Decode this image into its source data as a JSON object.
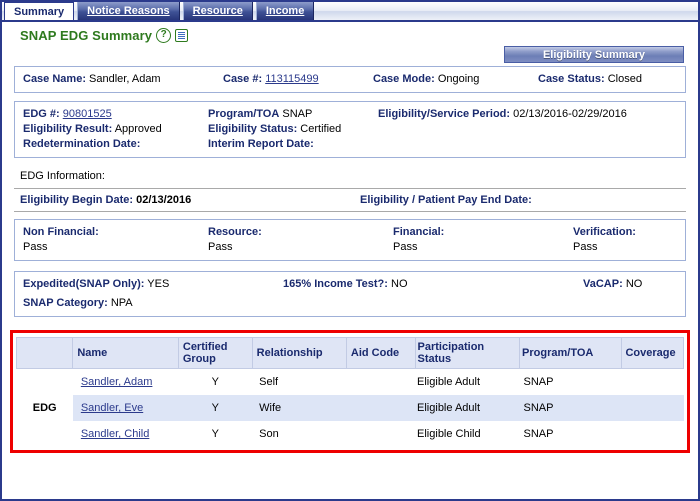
{
  "tabs": [
    {
      "label": "Summary",
      "active": true
    },
    {
      "label": "Notice Reasons",
      "active": false
    },
    {
      "label": "Resource",
      "active": false
    },
    {
      "label": "Income",
      "active": false
    }
  ],
  "page": {
    "title": "SNAP EDG Summary",
    "help_icon": "?",
    "doc_icon": "document-icon"
  },
  "buttons": {
    "eligibility_summary": "Eligibility Summary"
  },
  "case_bar": {
    "case_name_label": "Case Name:",
    "case_name_value": "Sandler, Adam",
    "case_number_label": "Case #:",
    "case_number_value": "113115499",
    "case_mode_label": "Case Mode:",
    "case_mode_value": "Ongoing",
    "case_status_label": "Case Status:",
    "case_status_value": "Closed"
  },
  "edg_panel": {
    "edg_num_label": "EDG #:",
    "edg_num_value": "90801525",
    "program_toa_label": "Program/TOA",
    "program_toa_value": "SNAP",
    "elig_service_period_label": "Eligibility/Service Period:",
    "elig_service_period_value": "02/13/2016-02/29/2016",
    "elig_result_label": "Eligibility Result:",
    "elig_result_value": "Approved",
    "elig_status_label": "Eligibility Status:",
    "elig_status_value": "Certified",
    "redetermination_label": "Redetermination Date:",
    "redetermination_value": "",
    "interim_report_label": "Interim Report Date:",
    "interim_report_value": ""
  },
  "edg_information": {
    "heading": "EDG Information:",
    "begin_date_label": "Eligibility Begin Date:",
    "begin_date_value": "02/13/2016",
    "end_date_label": "Eligibility / Patient Pay End Date:",
    "end_date_value": ""
  },
  "status_panel": {
    "non_financial_label": "Non Financial:",
    "non_financial_value": "Pass",
    "resource_label": "Resource:",
    "resource_value": "Pass",
    "financial_label": "Financial:",
    "financial_value": "Pass",
    "verification_label": "Verification:",
    "verification_value": "Pass"
  },
  "snap_panel": {
    "expedited_label": "Expedited(SNAP Only):",
    "expedited_value": "YES",
    "income_test_label": "165% Income Test?:",
    "income_test_value": "NO",
    "vacap_label": "VaCAP:",
    "vacap_value": "NO",
    "snap_category_label": "SNAP Category:",
    "snap_category_value": "NPA"
  },
  "member_table": {
    "group_label": "EDG",
    "columns": [
      "",
      "Name",
      "Certified Group",
      "Relationship",
      "Aid Code",
      "Participation Status",
      "Program/TOA",
      "Coverage"
    ],
    "rows": [
      {
        "name": "Sandler, Adam",
        "certified_group": "Y",
        "relationship": "Self",
        "aid_code": "",
        "participation_status": "Eligible Adult",
        "program_toa": "SNAP",
        "coverage": ""
      },
      {
        "name": "Sandler, Eve",
        "certified_group": "Y",
        "relationship": "Wife",
        "aid_code": "",
        "participation_status": "Eligible Adult",
        "program_toa": "SNAP",
        "coverage": ""
      },
      {
        "name": "Sandler, Child",
        "certified_group": "Y",
        "relationship": "Son",
        "aid_code": "",
        "participation_status": "Eligible Child",
        "program_toa": "SNAP",
        "coverage": ""
      }
    ]
  },
  "colors": {
    "frame_border": "#2b3a8c",
    "title_green": "#2e7a1e",
    "label_blue": "#1a2a6e",
    "link_blue": "#2b3a8c",
    "header_fill": "#dfe5f5",
    "highlight_red": "#ee0000",
    "row_alt": "#dde5f6"
  }
}
